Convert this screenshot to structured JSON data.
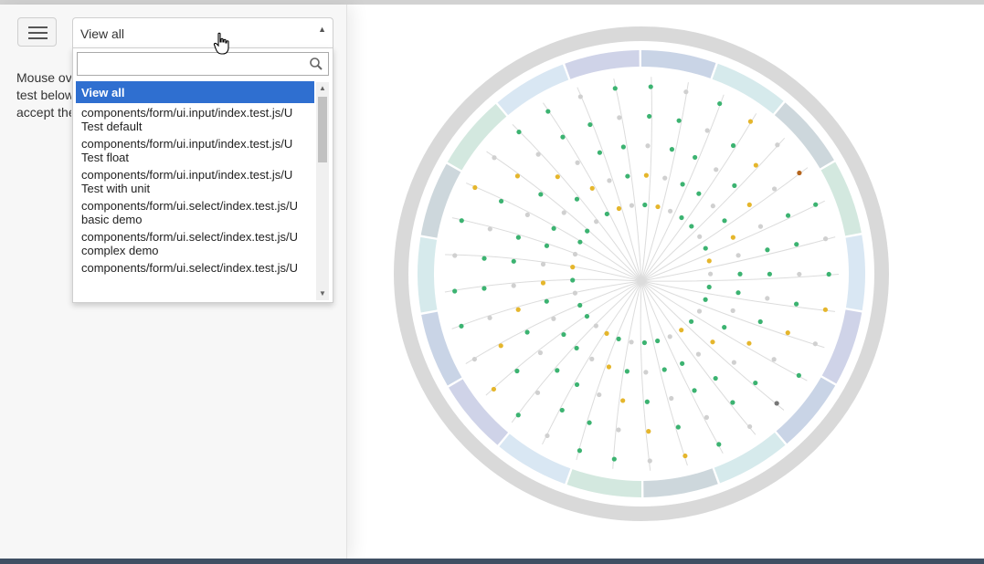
{
  "toolbar": {
    "menu_icon": "hamburger-icon"
  },
  "description": {
    "line1": "Mouse over",
    "line2": "test below",
    "line3": "accept the"
  },
  "select": {
    "value": "View all",
    "arrow": "▲",
    "search_value": "",
    "search_icon": "search-icon",
    "options": [
      {
        "line1": "View all",
        "line2": ""
      },
      {
        "line1": "components/form/ui.input/index.test.js/U",
        "line2": "Test default"
      },
      {
        "line1": "components/form/ui.input/index.test.js/U",
        "line2": "Test float"
      },
      {
        "line1": "components/form/ui.input/index.test.js/U",
        "line2": "Test with unit"
      },
      {
        "line1": "components/form/ui.select/index.test.js/U",
        "line2": "basic demo"
      },
      {
        "line1": "components/form/ui.select/index.test.js/U",
        "line2": "complex demo"
      },
      {
        "line1": "components/form/ui.select/index.test.js/U",
        "line2": ""
      }
    ]
  },
  "colors": {
    "ring_outer": "#d9d9d9",
    "pass": "#3cb371",
    "warn": "#e5b62c",
    "skip": "#d0d0d0",
    "fail": "#b5651d",
    "other": "#777777",
    "sectors": [
      "#c9d4e6",
      "#d6eaec",
      "#cdd7dc",
      "#d3e8df",
      "#d9e7f3",
      "#cfd3e8"
    ]
  },
  "viz": {
    "branch_count": 33
  }
}
